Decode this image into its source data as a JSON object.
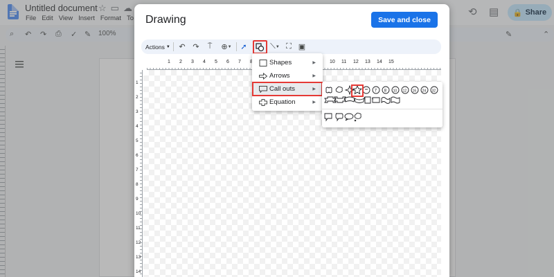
{
  "docs": {
    "title": "Untitled document",
    "menu": [
      "File",
      "Edit",
      "View",
      "Insert",
      "Format",
      "To"
    ],
    "share_label": "Share",
    "zoom": "100%"
  },
  "dialog": {
    "title": "Drawing",
    "save_label": "Save and close",
    "toolbar": {
      "actions_label": "Actions"
    },
    "ruler_numbers": [
      "1",
      "2",
      "3",
      "4",
      "5",
      "6",
      "7",
      "8",
      "9",
      "10",
      "11",
      "12",
      "13",
      "14",
      "15"
    ],
    "left_ruler_numbers": [
      "1",
      "2",
      "3",
      "4",
      "5",
      "6",
      "7",
      "8",
      "9",
      "10",
      "11",
      "12",
      "13",
      "14"
    ]
  },
  "shape_menu": {
    "items": [
      {
        "label": "Shapes",
        "icon": "square-icon"
      },
      {
        "label": "Arrows",
        "icon": "arrow-right-icon"
      },
      {
        "label": "Call outs",
        "icon": "speech-bubble-icon"
      },
      {
        "label": "Equation",
        "icon": "plus-icon"
      }
    ],
    "highlighted": "Call outs"
  },
  "callouts_submenu": {
    "row1_icons": [
      "wavy-callout-icon",
      "cloud-callout-icon",
      "four-point-star-icon",
      "five-point-star-icon",
      "star-6-icon",
      "star-7-icon",
      "star-8-icon",
      "star-10-icon",
      "star-12-icon",
      "star-16-icon",
      "star-24-icon",
      "star-32-icon"
    ],
    "row2_icons": [
      "ribbon-up-icon",
      "ribbon-down-icon",
      "curved-ribbon-up-icon",
      "curved-ribbon-down-icon",
      "vertical-scroll-icon",
      "horizontal-scroll-icon",
      "wave-icon",
      "double-wave-icon"
    ],
    "row3_icons": [
      "rectangular-callout-icon",
      "rounded-rectangular-callout-icon",
      "oval-callout-icon",
      "cloud-callout-2-icon"
    ],
    "selected": "five-point-star-icon"
  }
}
